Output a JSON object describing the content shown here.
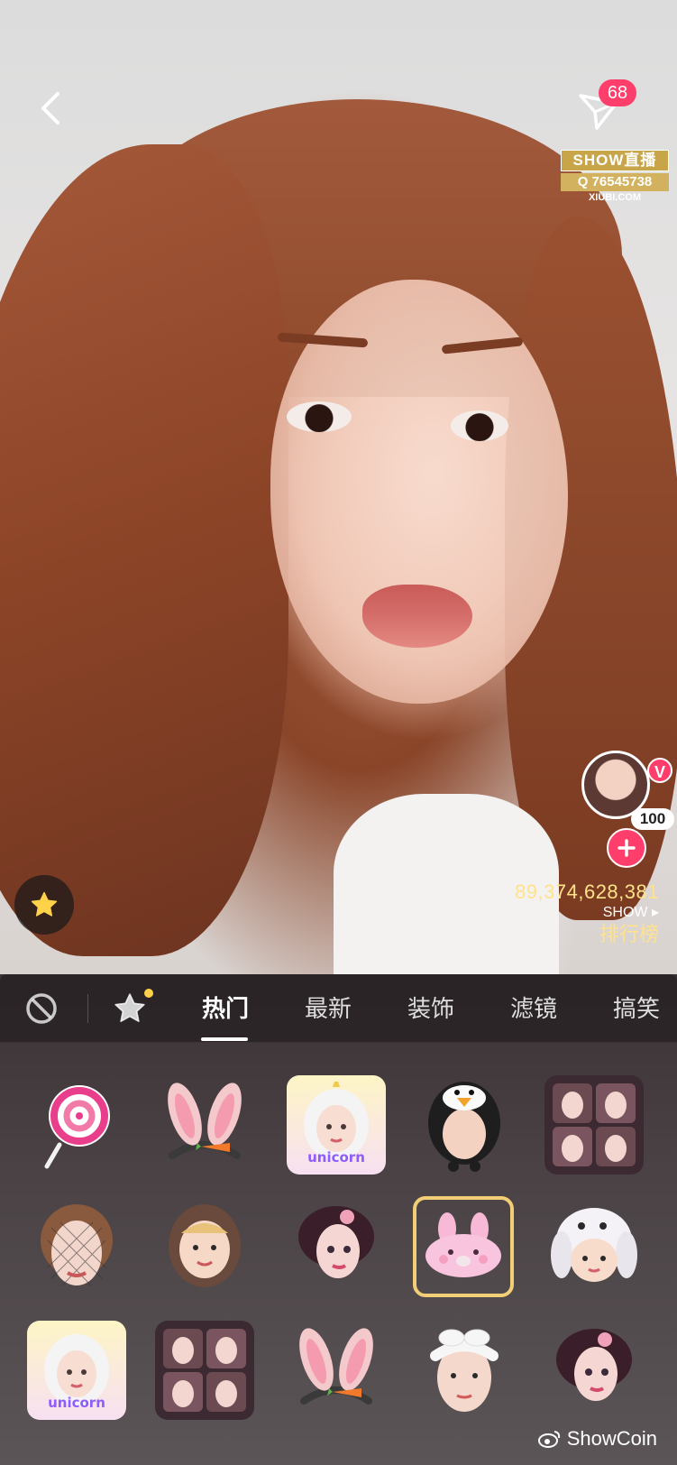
{
  "header": {
    "share_count": "68"
  },
  "watermark": {
    "show_text": "SHOW直播",
    "q_number": "Q 76545738",
    "site": "XIUBI.COM"
  },
  "ranking": {
    "level": "100",
    "v_label": "V",
    "count": "89,374,628,381",
    "show_label": "SHOW ▸",
    "title": "排行榜"
  },
  "tabs": [
    {
      "label": "热门",
      "active": true
    },
    {
      "label": "最新"
    },
    {
      "label": "装饰"
    },
    {
      "label": "滤镜"
    },
    {
      "label": "搞笑"
    }
  ],
  "stickers": [
    {
      "name": "lollipop"
    },
    {
      "name": "bunny-ears-carrot"
    },
    {
      "name": "unicorn-girl",
      "label": "unicorn"
    },
    {
      "name": "penguin-hat"
    },
    {
      "name": "face-collage"
    },
    {
      "name": "veil-face"
    },
    {
      "name": "child-hood"
    },
    {
      "name": "cartoon-girl"
    },
    {
      "name": "pink-bunny-mask",
      "selected": true
    },
    {
      "name": "bunny-hat-kid"
    },
    {
      "name": "unicorn-girl-2",
      "label": "unicorn"
    },
    {
      "name": "face-collage-2"
    },
    {
      "name": "bunny-ears-carrot-2"
    },
    {
      "name": "white-headband"
    },
    {
      "name": "cartoon-girl-2"
    }
  ],
  "brand": {
    "text": "ShowCoin"
  },
  "colors": {
    "accent_pink": "#ff3e6c",
    "gold": "#ffe28a",
    "selected_border": "#f2cf76"
  }
}
